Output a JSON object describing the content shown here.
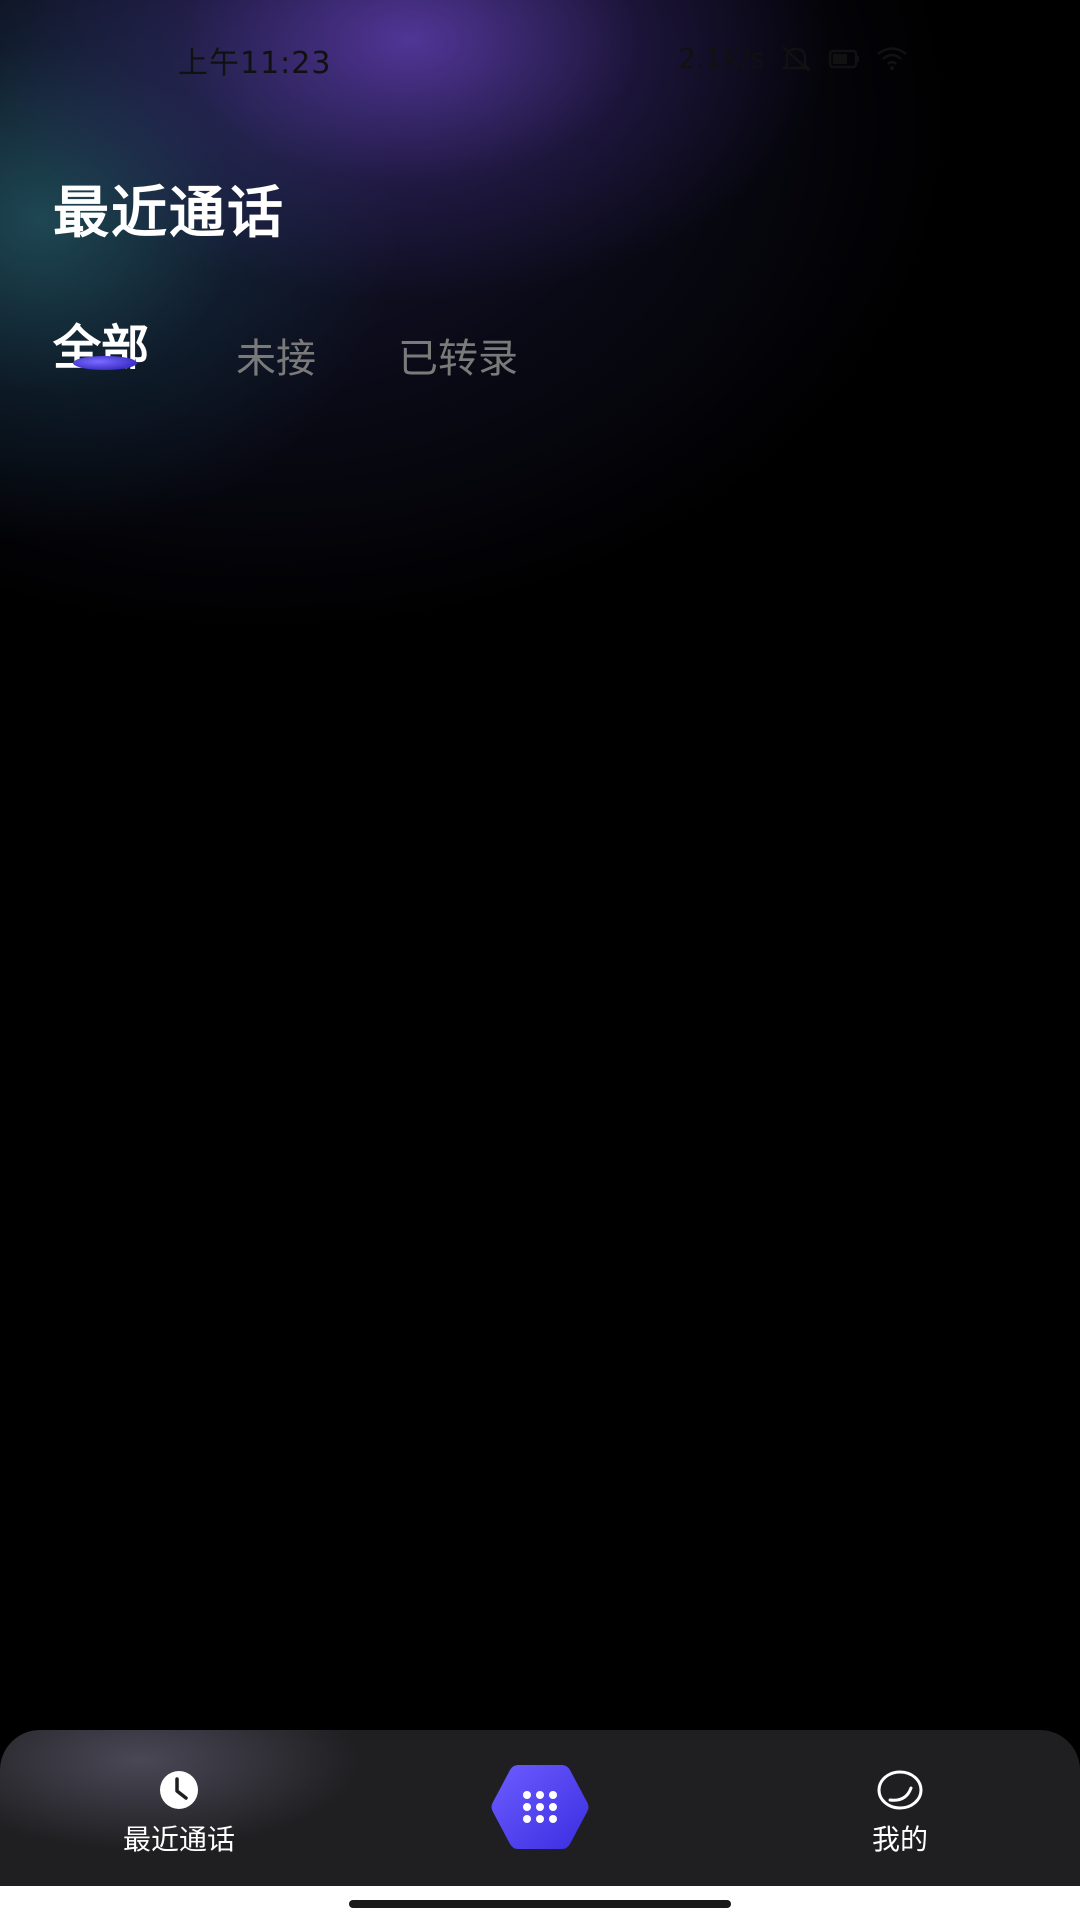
{
  "status_bar": {
    "time": "上午11:23",
    "network_speed": "2.1K/s",
    "icons": [
      "mute-icon",
      "battery-icon",
      "wifi-icon"
    ]
  },
  "header": {
    "title": "最近通话"
  },
  "tabs": [
    {
      "label": "全部",
      "active": true
    },
    {
      "label": "未接",
      "active": false
    },
    {
      "label": "已转录",
      "active": false
    }
  ],
  "bottom_nav": {
    "items": [
      {
        "label": "最近通话",
        "icon": "clock-icon",
        "active": true
      },
      {
        "label": "",
        "icon": "dialpad-icon",
        "active": false
      },
      {
        "label": "我的",
        "icon": "profile-icon",
        "active": false
      }
    ]
  },
  "colors": {
    "accent": "#4f46e5",
    "accent_light": "#6d5cff",
    "background": "#000000",
    "nav_background": "#1f1f21",
    "inactive_tab": "#7a7a7a"
  }
}
